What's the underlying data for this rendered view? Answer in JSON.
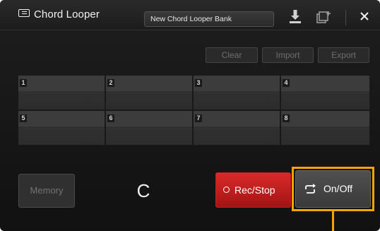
{
  "window": {
    "title": "Chord Looper",
    "bank_name": "New Chord Looper Bank",
    "icons": {
      "app": "chord-looper-icon",
      "save": "save-icon",
      "new_bank": "new-bank-icon",
      "close": "close-icon"
    }
  },
  "actions": {
    "clear_label": "Clear",
    "import_label": "Import",
    "export_label": "Export"
  },
  "memory_slots": [
    {
      "number": "1"
    },
    {
      "number": "2"
    },
    {
      "number": "3"
    },
    {
      "number": "4"
    },
    {
      "number": "5"
    },
    {
      "number": "6"
    },
    {
      "number": "7"
    },
    {
      "number": "8"
    }
  ],
  "controls": {
    "memory_label": "Memory",
    "current_chord": "C",
    "rec_stop_label": "Rec/Stop",
    "on_off_label": "On/Off"
  },
  "colors": {
    "rec_button": "#c81e1e",
    "highlight": "#f5a300"
  }
}
